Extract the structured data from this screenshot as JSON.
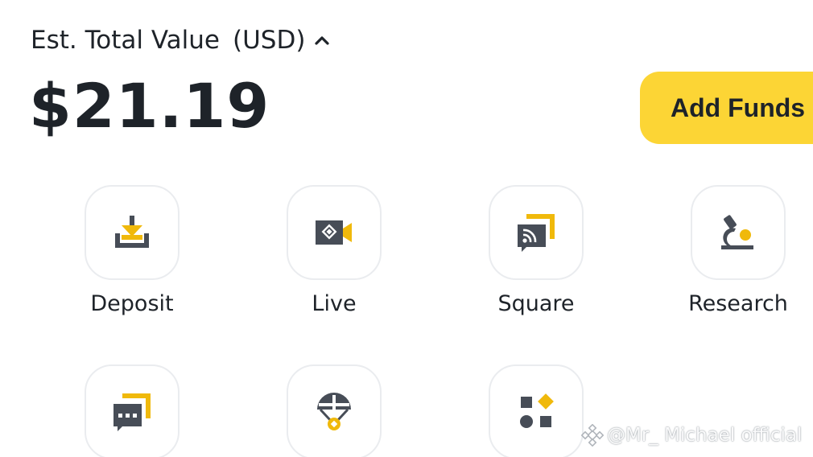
{
  "header": {
    "label": "Est. Total Value",
    "currency": "(USD)",
    "toggle_icon": "chevron-up-icon"
  },
  "balance": {
    "value": "$21.19"
  },
  "actions": {
    "add_funds_label": "Add Funds"
  },
  "shortcuts": [
    {
      "label": "Deposit",
      "icon": "deposit-icon"
    },
    {
      "label": "Live",
      "icon": "live-video-icon"
    },
    {
      "label": "Square",
      "icon": "square-feed-icon"
    },
    {
      "label": "Research",
      "icon": "microscope-icon"
    },
    {
      "label": "",
      "icon": "chat-icon"
    },
    {
      "label": "",
      "icon": "parachute-icon"
    },
    {
      "label": "",
      "icon": "more-apps-icon"
    }
  ],
  "watermark": {
    "text": "@Mr_ Michael official",
    "icon": "binance-logo-icon"
  },
  "colors": {
    "accent": "#fcd535",
    "icon_yellow": "#f0b90b",
    "icon_dark": "#474d57",
    "text": "#1e2329",
    "tile_border": "#eaecef"
  }
}
